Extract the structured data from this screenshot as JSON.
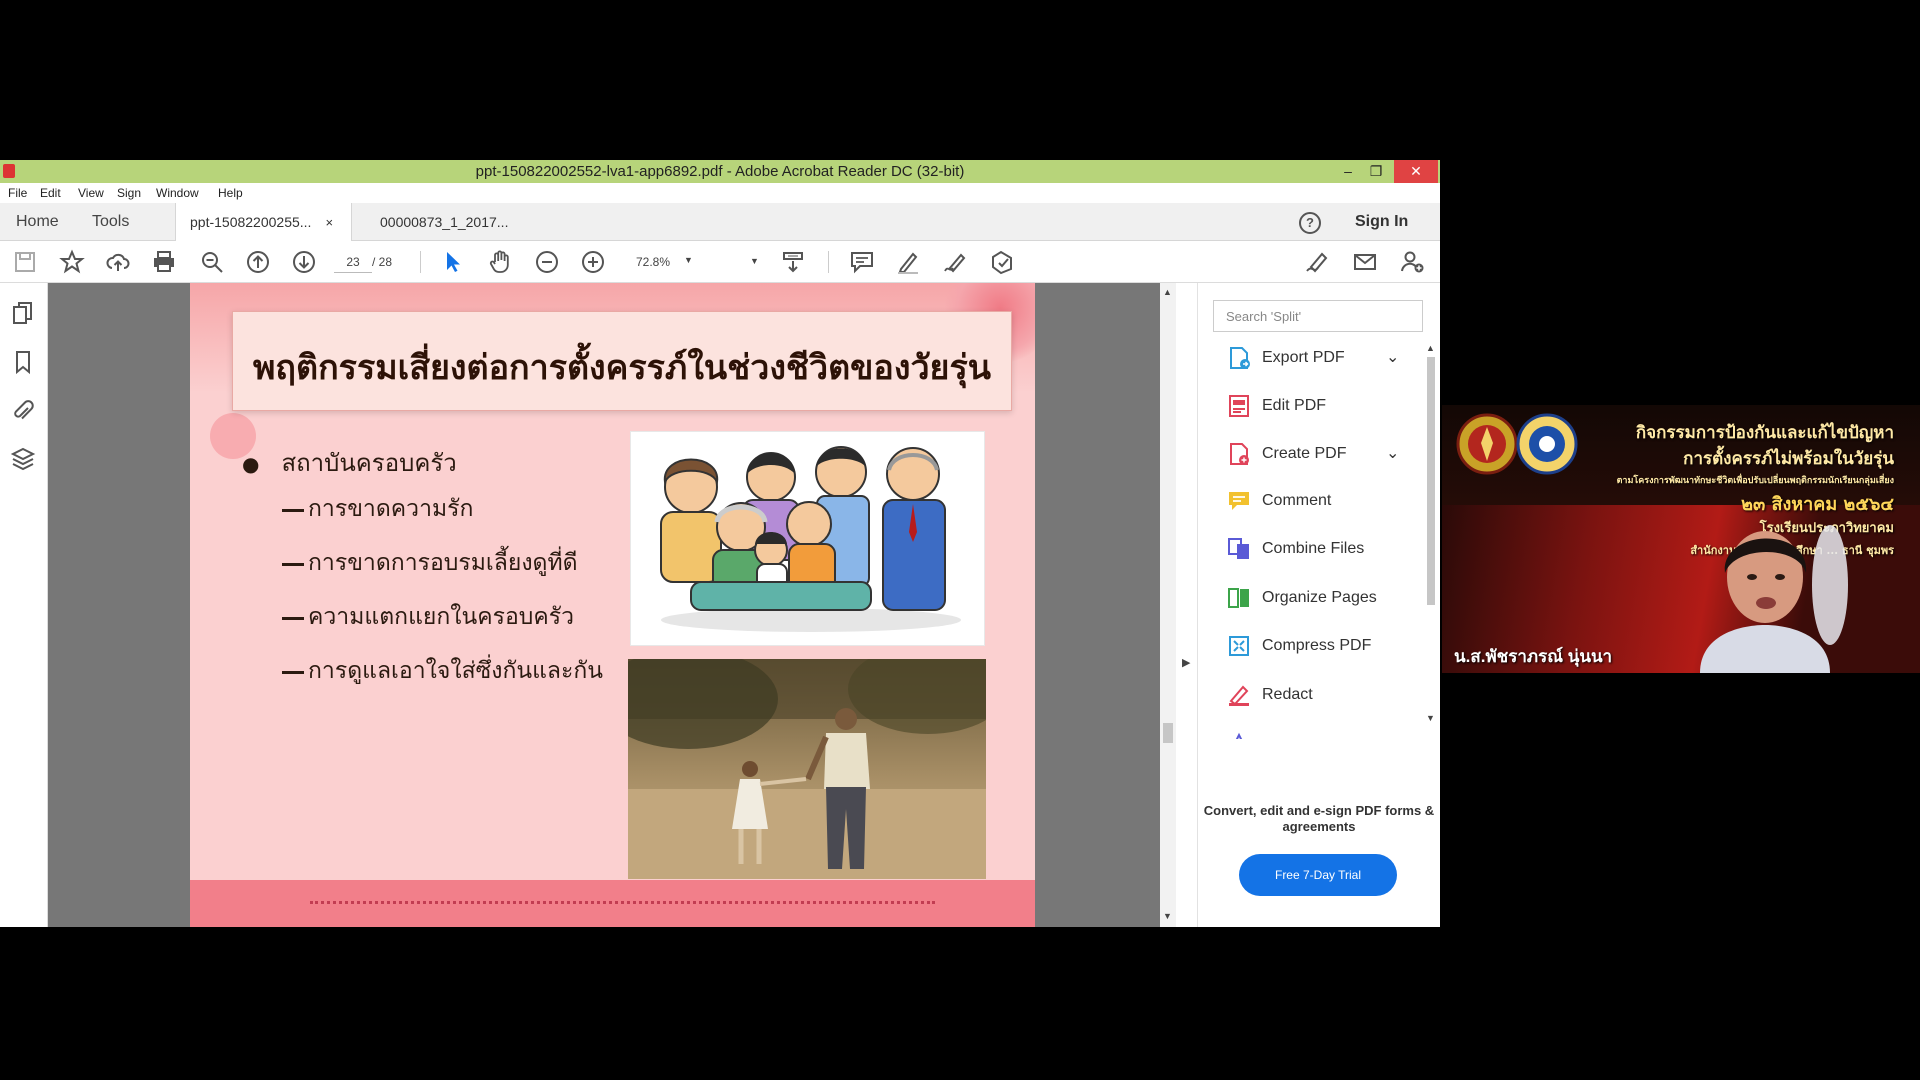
{
  "window": {
    "title": "ppt-150822002552-lva1-app6892.pdf - Adobe Acrobat Reader DC (32-bit)",
    "minimize": "–",
    "restore": "❐",
    "close": "✕"
  },
  "menu": [
    "File",
    "Edit",
    "View",
    "Sign",
    "Window",
    "Help"
  ],
  "tabs": {
    "home": "Home",
    "tools": "Tools",
    "doc1": "ppt-15082200255...",
    "doc1_close": "×",
    "doc2": "00000873_1_2017...",
    "help": "?",
    "sign_in": "Sign In"
  },
  "toolbar": {
    "page_current": "23",
    "page_total": "/ 28",
    "zoom": "72.8%"
  },
  "slide": {
    "title": "พฤติกรรมเสี่ยงต่อการตั้งครรภ์ในช่วงชีวิตของวัยรุ่น",
    "bullet": "สถาบันครอบครัว",
    "sub_bullets": [
      "การขาดความรัก",
      "การขาดการอบรมเลี้ยงดูที่ดี",
      "ความแตกแยกในครอบครัว",
      "การดูแลเอาใจใส่ซึ่งกันและกัน"
    ]
  },
  "tool_panel": {
    "search_placeholder": "Search 'Split'",
    "tools": [
      {
        "label": "Export PDF",
        "icon": "export-pdf-icon",
        "color": "#2d9ad9",
        "has_chevron": true
      },
      {
        "label": "Edit PDF",
        "icon": "edit-pdf-icon",
        "color": "#e0445a",
        "has_chevron": false
      },
      {
        "label": "Create PDF",
        "icon": "create-pdf-icon",
        "color": "#e0445a",
        "has_chevron": true
      },
      {
        "label": "Comment",
        "icon": "comment-icon",
        "color": "#f2c12e",
        "has_chevron": false
      },
      {
        "label": "Combine Files",
        "icon": "combine-files-icon",
        "color": "#5a5ad6",
        "has_chevron": false
      },
      {
        "label": "Organize Pages",
        "icon": "organize-pages-icon",
        "color": "#3ca44a",
        "has_chevron": false
      },
      {
        "label": "Compress PDF",
        "icon": "compress-pdf-icon",
        "color": "#2d9ad9",
        "has_chevron": false
      },
      {
        "label": "Redact",
        "icon": "redact-icon",
        "color": "#e0445a",
        "has_chevron": false
      }
    ],
    "promo": "Convert, edit and e-sign PDF forms & agreements",
    "trial_button": "Free 7-Day Trial"
  },
  "webcam": {
    "line1": "กิจกรรมการป้องกันและแก้ไขปัญหา",
    "line2": "การตั้งครรภ์ไม่พร้อมในวัยรุ่น",
    "line3": "ตามโครงการพัฒนาทักษะชีวิตเพื่อปรับเปลี่ยนพฤติกรรมนักเรียนกลุ่มเสี่ยง",
    "line4": "๒๓ สิงหาคม ๒๕๖๔",
    "line5": "โรงเรียนประภาวิทยาคม",
    "line6": "สำนักงานเขตพื้นที่การศึกษา ... ธานี ชุมพร",
    "name": "น.ส.พัชราภรณ์ นุ่นนา"
  }
}
